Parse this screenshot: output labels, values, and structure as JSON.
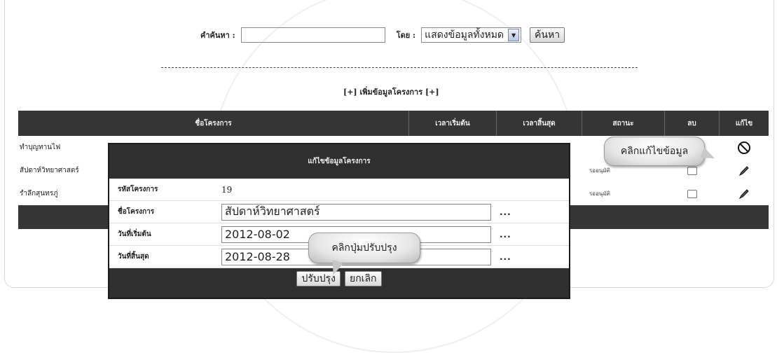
{
  "search": {
    "label": "คำค้นหา :",
    "value": "",
    "by_label": "โดย :",
    "by_selected": "แสดงข้อมูลทั้งหมด",
    "button": "ค้นหา"
  },
  "add_link": "[+] เพิ่มข้อมูลโครงการ [+]",
  "table": {
    "headers": [
      "ชื่อโครงการ",
      "เวลาเริ่มต้น",
      "เวลาสิ้นสุด",
      "สถานะ",
      "ลบ",
      "แก้ไข"
    ],
    "rows": [
      {
        "name": "ทำบุญทานไฟ",
        "start": "",
        "end": "",
        "status": "",
        "delete": "",
        "edit_icon": "cancel-icon"
      },
      {
        "name": "สัปดาห์วิทยาศาสตร์",
        "start": "",
        "end": "",
        "status": "รออนุมัติ",
        "delete": "",
        "edit_icon": "pencil-icon"
      },
      {
        "name": "รำลึกสุนทรภู่",
        "start": "",
        "end": "",
        "status": "รออนุมัติ",
        "delete": "",
        "edit_icon": "pencil-icon"
      }
    ]
  },
  "modal": {
    "title": "แก้ไขข้อมูลโครงการ",
    "fields": [
      {
        "label": "รหัสโครงการ",
        "value": "19"
      },
      {
        "label": "ชื่อโครงการ",
        "value": "สัปดาห์วิทยาศาสตร์",
        "extra": "..."
      },
      {
        "label": "วันที่เริ่มต้น",
        "value": "2012-08-02",
        "extra": "..."
      },
      {
        "label": "วันที่สิ้นสุด",
        "value": "2012-08-28",
        "extra": "..."
      }
    ],
    "update_button": "ปรับปรุง",
    "cancel_button": "ยกเลิก"
  },
  "callouts": {
    "edit_hint": "คลิกแก้ไขข้อมูล",
    "update_hint": "คลิกปุ่มปรับปรุง"
  }
}
